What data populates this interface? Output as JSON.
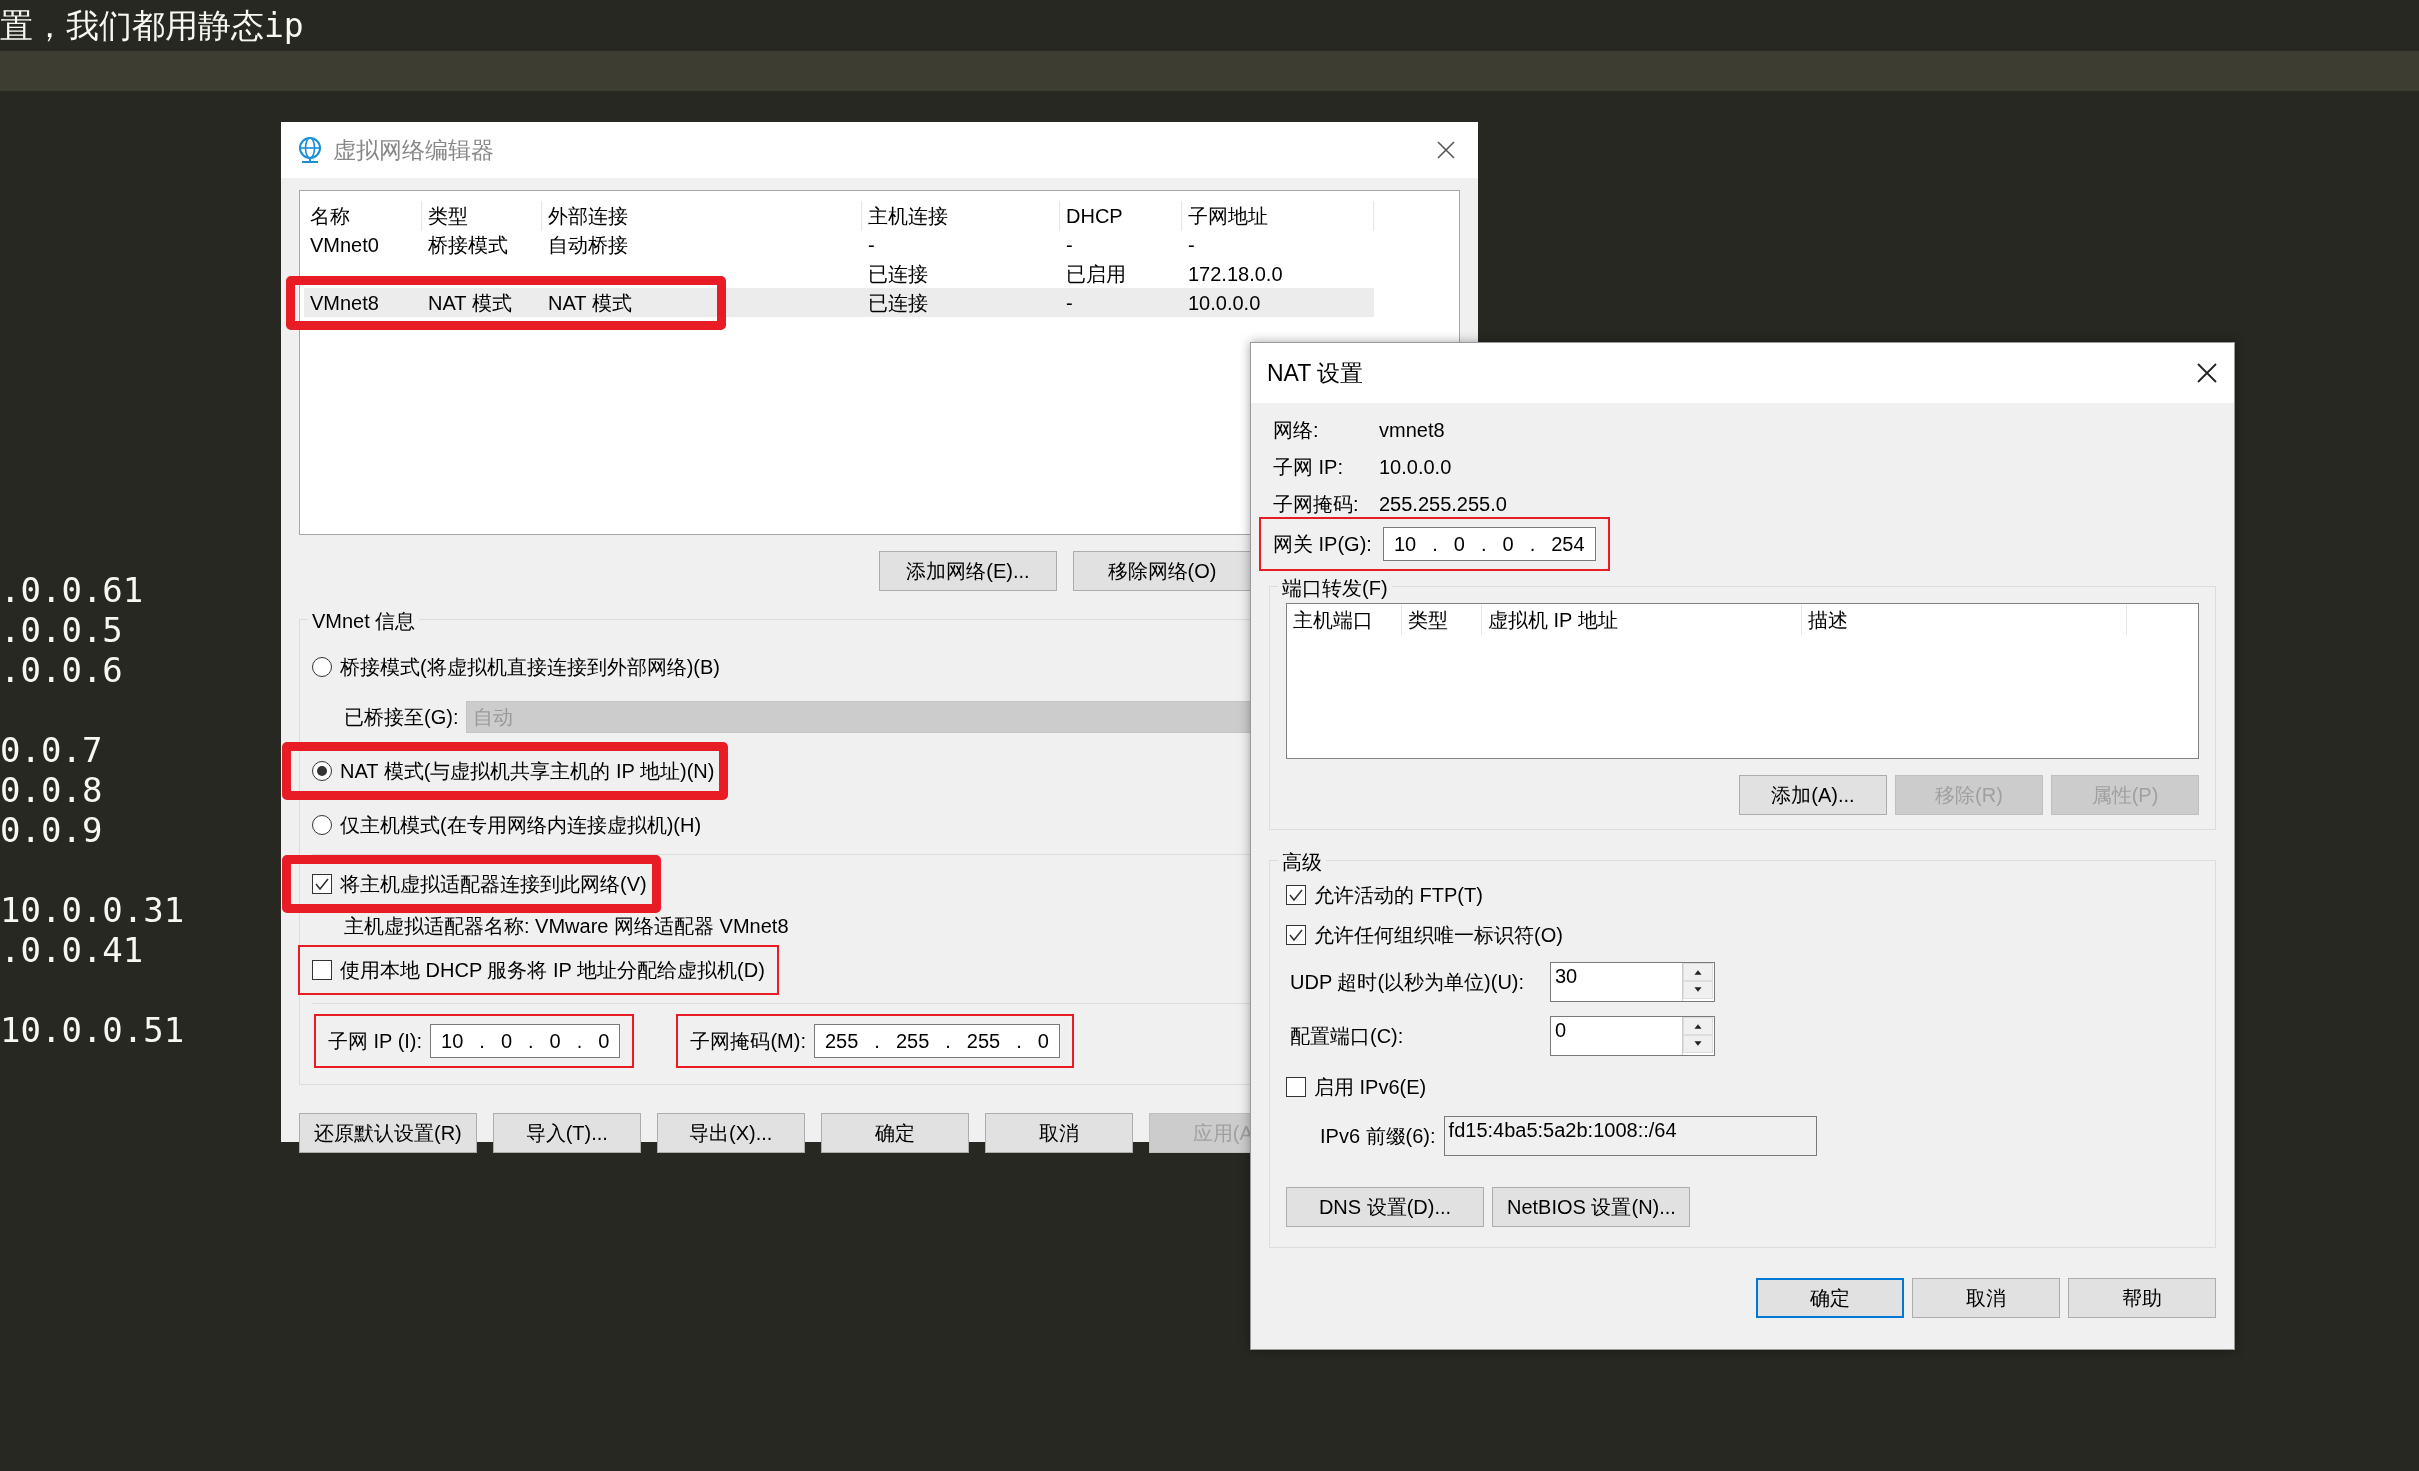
{
  "editor": {
    "heading": "置，我们都用静态ip",
    "line_groups": [
      [
        ".0.0.61",
        ".0.0.5",
        ".0.0.6"
      ],
      [
        "0.0.7",
        "0.0.8",
        "0.0.9"
      ],
      [
        "10.0.0.31",
        ".0.0.41"
      ],
      [
        "10.0.0.51"
      ]
    ]
  },
  "network_editor": {
    "title": "虚拟网络编辑器",
    "columns": [
      "名称",
      "类型",
      "外部连接",
      "主机连接",
      "DHCP",
      "子网地址"
    ],
    "rows": [
      {
        "name": "VMnet0",
        "type": "桥接模式",
        "external": "自动桥接",
        "host": "-",
        "dhcp": "-",
        "subnet": "-",
        "selected": false
      },
      {
        "host": "已连接",
        "dhcp": "已启用",
        "subnet": "172.18.0.0",
        "selected": false
      },
      {
        "name": "VMnet8",
        "type": "NAT 模式",
        "external": "NAT 模式",
        "host": "已连接",
        "dhcp": "-",
        "subnet": "10.0.0.0",
        "selected": true,
        "highlight": {
          "kind": "thick"
        }
      }
    ],
    "list_buttons": [
      {
        "label": "添加网络(E)...",
        "disabled": false
      },
      {
        "label": "移除网络(O)",
        "disabled": false
      }
    ],
    "info_label": "VMnet 信息",
    "modes": [
      {
        "label": "桥接模式(将虚拟机直接连接到外部网络)(B)",
        "selected": false
      },
      {
        "label": "NAT 模式(与虚拟机共享主机的 IP 地址)(N)",
        "selected": true,
        "highlight": {
          "kind": "thick"
        }
      },
      {
        "label": "仅主机模式(在专用网络内连接虚拟机)(H)",
        "selected": false
      }
    ],
    "bridged_to": {
      "label": "已桥接至(G):",
      "value": "自动",
      "disabled": true
    },
    "options": [
      {
        "label": "将主机虚拟适配器连接到此网络(V)",
        "checked": true,
        "highlight": {
          "kind": "thick"
        }
      },
      {
        "label": "使用本地 DHCP 服务将 IP 地址分配给虚拟机(D)",
        "checked": false,
        "highlight": {
          "kind": "thin"
        }
      }
    ],
    "adapter_name": "主机虚拟适配器名称: VMware 网络适配器 VMnet8",
    "subnet_ip": {
      "label": "子网 IP (I):",
      "octets": [
        "10",
        "0",
        "0",
        "0"
      ],
      "separator": ".",
      "highlight": {
        "kind": "thin"
      }
    },
    "subnet_mask": {
      "label": "子网掩码(M):",
      "octets": [
        "255",
        "255",
        "255",
        "0"
      ],
      "separator": ".",
      "highlight": {
        "kind": "thin"
      }
    },
    "footer_buttons": [
      {
        "label": "还原默认设置(R)",
        "disabled": false
      },
      {
        "label": "导入(T)...",
        "disabled": false
      },
      {
        "label": "导出(X)...",
        "disabled": false
      },
      {
        "label": "确定",
        "disabled": false
      },
      {
        "label": "取消",
        "disabled": false
      },
      {
        "label": "应用(A",
        "disabled": true
      }
    ]
  },
  "nat_settings": {
    "title": "NAT 设置",
    "info": [
      {
        "label": "网络:",
        "value": "vmnet8"
      },
      {
        "label": "子网 IP:",
        "value": "10.0.0.0"
      },
      {
        "label": "子网掩码:",
        "value": "255.255.255.0"
      }
    ],
    "gateway": {
      "label": "网关 IP(G):",
      "octets": [
        "10",
        "0",
        "0",
        "254"
      ],
      "separator": ".",
      "highlight": {
        "kind": "thin"
      }
    },
    "port_forwarding": {
      "label": "端口转发(F)",
      "columns": [
        "主机端口",
        "类型",
        "虚拟机 IP 地址",
        "描述"
      ],
      "buttons": [
        {
          "label": "添加(A)...",
          "disabled": false
        },
        {
          "label": "移除(R)",
          "disabled": true
        },
        {
          "label": "属性(P)",
          "disabled": true
        }
      ]
    },
    "advanced": {
      "label": "高级",
      "options": [
        {
          "label": "允许活动的 FTP(T)",
          "checked": true
        },
        {
          "label": "允许任何组织唯一标识符(O)",
          "checked": true
        }
      ],
      "spinners": [
        {
          "label": "UDP 超时(以秒为单位)(U):",
          "value": "30"
        },
        {
          "label": "配置端口(C):",
          "value": "0"
        }
      ],
      "ipv6": {
        "label": "启用 IPv6(E)",
        "checked": false
      },
      "prefix": {
        "label": "IPv6 前缀(6):",
        "value": "fd15:4ba5:5a2b:1008::/64"
      },
      "buttons": [
        {
          "label": "DNS 设置(D)...",
          "disabled": false
        },
        {
          "label": "NetBIOS 设置(N)...",
          "disabled": false
        }
      ]
    },
    "footer_buttons": [
      {
        "label": "确定",
        "default": true
      },
      {
        "label": "取消",
        "default": false
      },
      {
        "label": "帮助",
        "default": false
      }
    ]
  }
}
